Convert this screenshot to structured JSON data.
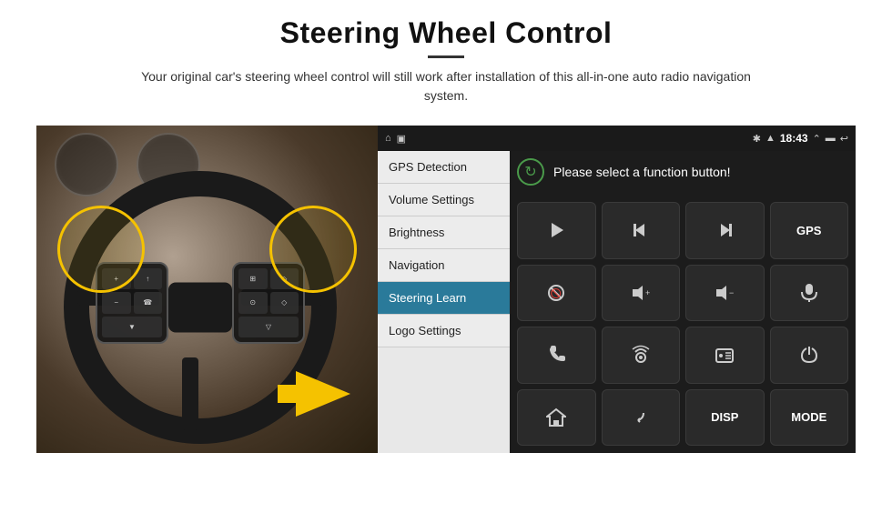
{
  "page": {
    "title": "Steering Wheel Control",
    "divider": true,
    "subtitle": "Your original car's steering wheel control will still work after installation of this all-in-one auto radio navigation system."
  },
  "status_bar": {
    "time": "18:43",
    "icons": [
      "home",
      "screenshot",
      "bluetooth",
      "wifi",
      "arrow-up",
      "battery",
      "back"
    ]
  },
  "menu": {
    "items": [
      {
        "label": "GPS Detection",
        "active": false
      },
      {
        "label": "Volume Settings",
        "active": false
      },
      {
        "label": "Brightness",
        "active": false
      },
      {
        "label": "Navigation",
        "active": false
      },
      {
        "label": "Steering Learn",
        "active": true
      },
      {
        "label": "Logo Settings",
        "active": false
      }
    ]
  },
  "panel": {
    "header_text": "Please select a function button!",
    "buttons": [
      {
        "type": "icon",
        "name": "play",
        "label": "Play"
      },
      {
        "type": "icon",
        "name": "skip-back",
        "label": "Skip Back"
      },
      {
        "type": "icon",
        "name": "skip-forward",
        "label": "Skip Forward"
      },
      {
        "type": "text",
        "name": "gps",
        "label": "GPS"
      },
      {
        "type": "icon",
        "name": "mute",
        "label": "Mute"
      },
      {
        "type": "icon",
        "name": "vol-up",
        "label": "Volume Up"
      },
      {
        "type": "icon",
        "name": "vol-down",
        "label": "Volume Down"
      },
      {
        "type": "icon",
        "name": "mic",
        "label": "Microphone"
      },
      {
        "type": "icon",
        "name": "phone",
        "label": "Phone"
      },
      {
        "type": "icon",
        "name": "radio",
        "label": "Radio"
      },
      {
        "type": "icon",
        "name": "radio2",
        "label": "Radio2"
      },
      {
        "type": "icon",
        "name": "power",
        "label": "Power"
      },
      {
        "type": "icon",
        "name": "home",
        "label": "Home"
      },
      {
        "type": "icon",
        "name": "back",
        "label": "Back"
      },
      {
        "type": "text",
        "name": "disp",
        "label": "DISP"
      },
      {
        "type": "text",
        "name": "mode",
        "label": "MODE"
      }
    ]
  }
}
